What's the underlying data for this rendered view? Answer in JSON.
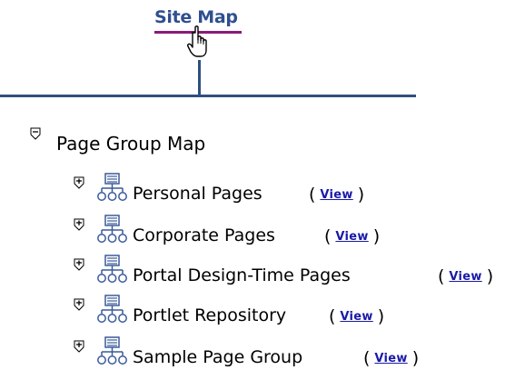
{
  "header": {
    "sitemap_label": "Site Map"
  },
  "tree": {
    "root_label": "Page Group Map",
    "view_label": "View",
    "paren_open": "(",
    "paren_close": ")",
    "items": [
      {
        "label": "Personal Pages"
      },
      {
        "label": "Corporate Pages"
      },
      {
        "label": "Portal Design-Time Pages"
      },
      {
        "label": "Portlet Repository"
      },
      {
        "label": "Sample Page Group"
      }
    ]
  },
  "colors": {
    "link": "#2f4f8f",
    "view_link": "#1a1aa8",
    "connector": "#2f4f7f",
    "underline_accent": "#8b1a78",
    "icon": "#3a5a9a"
  },
  "icons": {
    "cursor": "hand-pointer-icon",
    "collapse": "collapse-minus-icon",
    "expand": "expand-plus-icon",
    "page_group": "page-group-tree-icon"
  }
}
